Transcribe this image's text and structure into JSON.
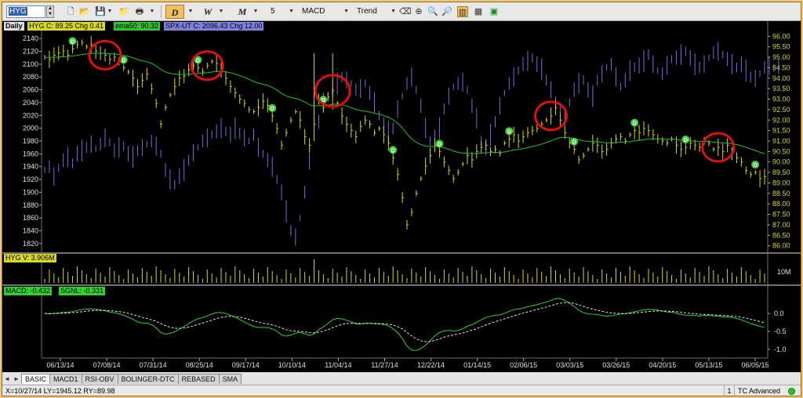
{
  "toolbar": {
    "symbol": "HYG",
    "period_daily": "D",
    "period_weekly": "W",
    "period_monthly": "M",
    "interval": "5",
    "indicator": "MACD",
    "tool": "Trend"
  },
  "panes": {
    "price": {
      "timeframe": "Daily",
      "legend_hyg": "HYG  C: 89.25  Chg 0.41",
      "legend_ema": "ema50: 90.32",
      "legend_spx": "SPX-UT  C: 2096.43  Chg 12.00"
    },
    "volume": {
      "legend": "HYG  V: 3.906M",
      "axis_label": "10M"
    },
    "macd": {
      "legend_macd": "MACD: -0.432",
      "legend_signal": "SGNL: -0.331"
    }
  },
  "chart_data": {
    "type": "bar",
    "x_dates": [
      "06/13/14",
      "07/08/14",
      "07/31/14",
      "08/25/14",
      "09/17/14",
      "10/10/14",
      "11/04/14",
      "11/27/14",
      "12/22/14",
      "01/14/15",
      "02/06/15",
      "03/03/15",
      "03/26/15",
      "04/20/15",
      "05/13/15",
      "06/05/15"
    ],
    "left_axis": {
      "label": "SPX-UT",
      "ticks": [
        2140,
        2120,
        2100,
        2080,
        2060,
        2040,
        2020,
        2000,
        1980,
        1960,
        1940,
        1920,
        1900,
        1880,
        1860,
        1840,
        1820
      ],
      "range": [
        1810,
        2150
      ]
    },
    "right_axis": {
      "label": "HYG",
      "ticks": [
        "96.00",
        "95.50",
        "95.00",
        "94.50",
        "94.00",
        "93.50",
        "93.00",
        "92.50",
        "92.00",
        "91.50",
        "91.00",
        "90.50",
        "90.00",
        "89.50",
        "89.00",
        "88.50",
        "88.00",
        "87.50",
        "87.00",
        "86.50",
        "86.00"
      ],
      "range": [
        85.8,
        96.2
      ]
    },
    "macd_axis": {
      "ticks": [
        "0.0",
        "-0.5",
        "-1.0"
      ],
      "range": [
        -1.2,
        0.55
      ]
    },
    "series": [
      {
        "name": "HYG",
        "color": "#d8d820",
        "values": [
          95.0,
          94.9,
          95.1,
          95.2,
          95.3,
          95.1,
          95.4,
          95.6,
          95.7,
          95.5,
          95.6,
          95.3,
          95.2,
          95.1,
          94.9,
          95.0,
          94.8,
          94.5,
          94.3,
          94.0,
          93.6,
          93.9,
          94.2,
          93.5,
          92.8,
          91.8,
          92.6,
          93.2,
          93.6,
          94.0,
          94.1,
          94.4,
          94.6,
          94.5,
          94.3,
          94.6,
          94.8,
          94.7,
          94.4,
          94.0,
          93.6,
          93.3,
          93.0,
          92.8,
          92.5,
          92.4,
          92.6,
          92.9,
          92.7,
          92.2,
          91.6,
          90.8,
          91.4,
          92.0,
          92.4,
          92.0,
          91.2,
          90.8,
          91.8,
          93.0,
          92.6,
          93.1,
          93.4,
          92.8,
          92.2,
          91.8,
          91.5,
          91.2,
          91.7,
          92.0,
          91.8,
          91.4,
          91.6,
          91.3,
          90.9,
          90.2,
          89.4,
          88.3,
          87.0,
          87.6,
          88.5,
          89.2,
          89.8,
          90.3,
          90.8,
          90.5,
          90.0,
          89.6,
          89.2,
          89.5,
          89.9,
          90.3,
          90.1,
          90.5,
          90.7,
          90.8,
          90.5,
          90.6,
          90.4,
          90.9,
          91.1,
          91.3,
          91.0,
          91.2,
          91.4,
          91.5,
          91.6,
          91.8,
          92.0,
          92.2,
          92.6,
          92.0,
          91.4,
          90.9,
          90.6,
          90.1,
          90.3,
          90.6,
          90.9,
          90.8,
          90.5,
          90.6,
          90.9,
          91.1,
          91.2,
          91.0,
          91.3,
          91.5,
          91.4,
          91.6,
          91.5,
          91.3,
          91.1,
          91.0,
          90.9,
          91.1,
          90.8,
          90.6,
          90.7,
          90.9,
          90.8,
          90.7,
          91.0,
          90.9,
          90.6,
          90.7,
          90.5,
          90.8,
          90.4,
          90.2,
          90.0,
          89.6,
          89.4,
          89.5,
          89.2,
          89.3
        ]
      },
      {
        "name": "SPX-UT",
        "color": "#7070d8",
        "values": [
          1935,
          1940,
          1925,
          1938,
          1950,
          1955,
          1945,
          1960,
          1965,
          1970,
          1975,
          1968,
          1975,
          1985,
          1978,
          1965,
          1970,
          1972,
          1960,
          1955,
          1965,
          1970,
          1975,
          1980,
          1972,
          1960,
          1935,
          1920,
          1912,
          1925,
          1935,
          1950,
          1962,
          1970,
          1980,
          1985,
          1990,
          1995,
          2000,
          1995,
          1990,
          2000,
          1992,
          1985,
          1980,
          1990,
          1970,
          1960,
          1950,
          1940,
          1920,
          1900,
          1870,
          1840,
          1830,
          1860,
          1900,
          1950,
          1990,
          2010,
          2040,
          2050,
          2060,
          2070,
          2080,
          2075,
          2070,
          2060,
          2062,
          2070,
          2055,
          2040,
          2020,
          2005,
          1995,
          2000,
          2030,
          2050,
          2070,
          2080,
          2060,
          2035,
          2000,
          1980,
          1985,
          2000,
          2030,
          2050,
          2065,
          2070,
          2072,
          2060,
          2035,
          2015,
          1980,
          1970,
          1990,
          2010,
          2035,
          2055,
          2070,
          2080,
          2090,
          2100,
          2105,
          2110,
          2100,
          2092,
          2075,
          2060,
          2045,
          2030,
          2015,
          2040,
          2060,
          2070,
          2075,
          2060,
          2050,
          2075,
          2085,
          2095,
          2100,
          2080,
          2065,
          2075,
          2090,
          2095,
          2098,
          2105,
          2115,
          2100,
          2090,
          2085,
          2098,
          2108,
          2110,
          2115,
          2120,
          2110,
          2100,
          2095,
          2100,
          2110,
          2118,
          2120,
          2115,
          2108,
          2100,
          2095,
          2100,
          2090,
          2080,
          2078,
          2085,
          2095,
          2098,
          2094,
          2096
        ]
      },
      {
        "name": "ema50",
        "color": "#20c020"
      },
      {
        "name": "MACD",
        "color": "#30d030"
      },
      {
        "name": "SGNL",
        "color": "#e0e0e0"
      }
    ],
    "annotations": [
      {
        "type": "circle",
        "color": "#e01010",
        "label": ""
      }
    ],
    "markers": {
      "label": "D",
      "color": "#40d040"
    }
  },
  "tabs": [
    "BASIC",
    "MACD1",
    "RSI-OBV",
    "BOLINGER-DTC",
    "REBASED",
    "SMA"
  ],
  "status": {
    "coords": "X=10/27/14 LY=1945.12 RY=89.98",
    "count": "1",
    "app": "TC Advanced"
  }
}
